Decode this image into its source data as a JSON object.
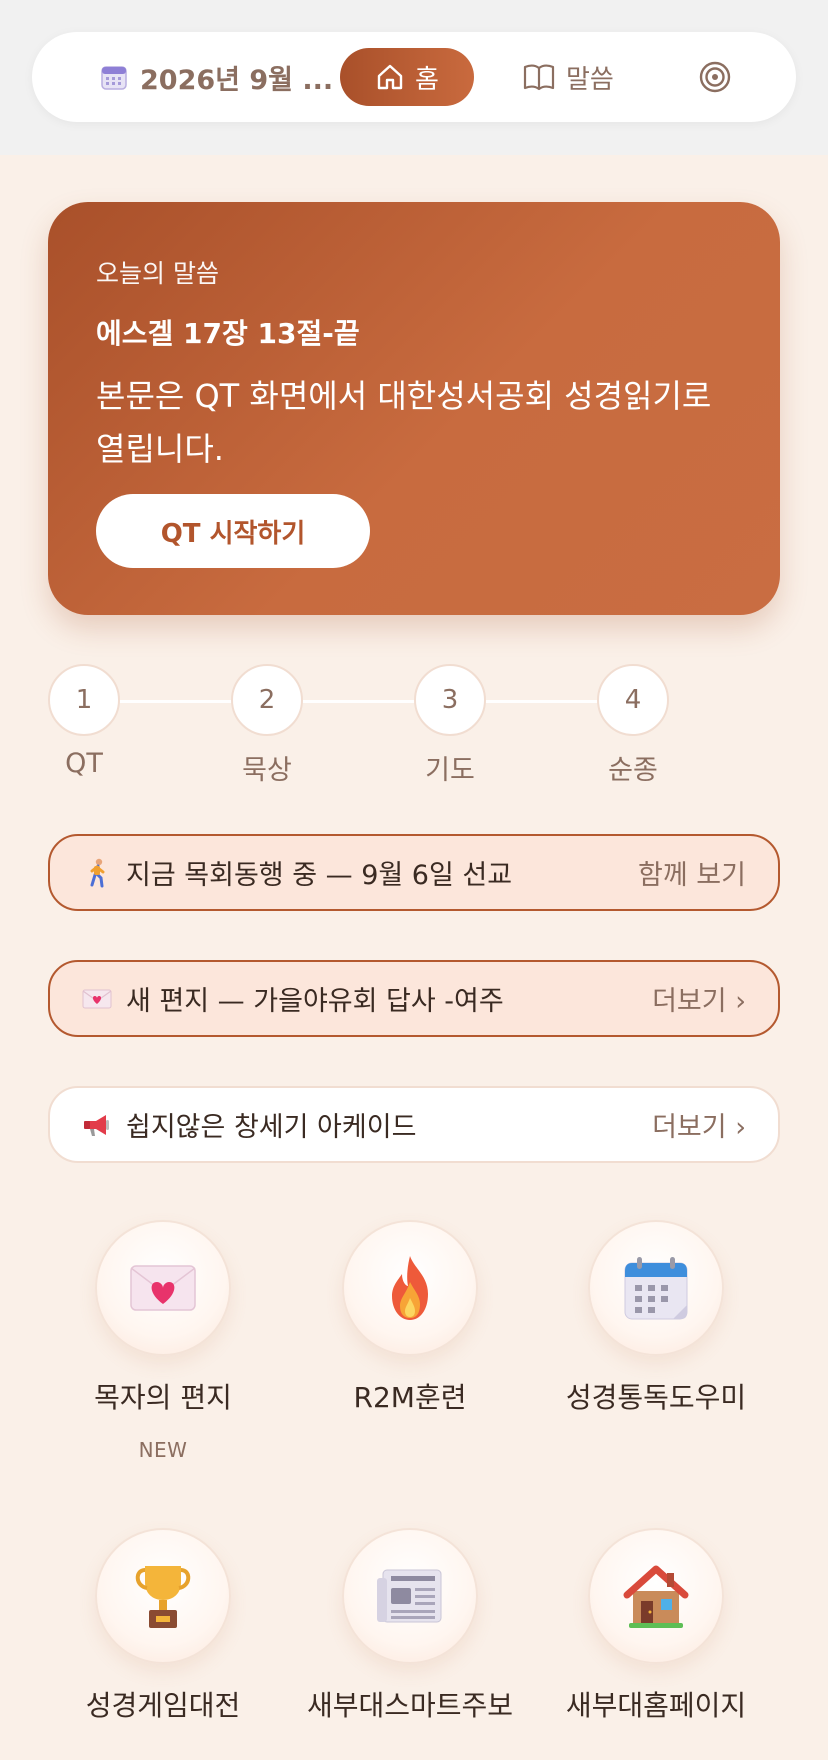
{
  "nav": {
    "date_label": "2026년 9월 ...",
    "home_label": "홈",
    "word_label": "말씀",
    "icons": {
      "date": "calendar-icon",
      "home": "home-icon",
      "word": "book-icon",
      "target": "target-icon"
    }
  },
  "hero": {
    "kicker": "오늘의 말씀",
    "reference": "에스겔 17장 13절-끝",
    "body": "본문은 QT 화면에서 대한성서공회 성경읽기로 열립니다.",
    "button_label": "QT 시작하기"
  },
  "steps": [
    {
      "number": "1",
      "label": "QT"
    },
    {
      "number": "2",
      "label": "묵상"
    },
    {
      "number": "3",
      "label": "기도"
    },
    {
      "number": "4",
      "label": "순종"
    }
  ],
  "banners": [
    {
      "icon": "walking-person-icon",
      "text": "지금 목회동행 중 — 9월 6일 선교",
      "action": "함께 보기"
    },
    {
      "icon": "love-letter-icon",
      "text": "새 편지 — 가을야유회 답사 -여주",
      "action": "더보기 ›"
    },
    {
      "icon": "megaphone-icon",
      "text": "쉽지않은 창세기 아케이드",
      "action": "더보기 ›"
    }
  ],
  "tiles": [
    {
      "icon": "love-letter-icon",
      "label": "목자의 편지",
      "badge": "NEW"
    },
    {
      "icon": "fire-icon",
      "label": "R2M훈련",
      "badge": ""
    },
    {
      "icon": "calendar-icon",
      "label": "성경통독도우미",
      "badge": ""
    },
    {
      "icon": "trophy-icon",
      "label": "성경게임대전",
      "badge": ""
    },
    {
      "icon": "newspaper-icon",
      "label": "새부대스마트주보",
      "badge": ""
    },
    {
      "icon": "house-icon",
      "label": "새부대홈페이지",
      "badge": ""
    }
  ],
  "colors": {
    "accent": "#A9502A",
    "accent_light": "#C96A3E",
    "background": "#FAF0E8",
    "muted_text": "#8B6E60"
  }
}
